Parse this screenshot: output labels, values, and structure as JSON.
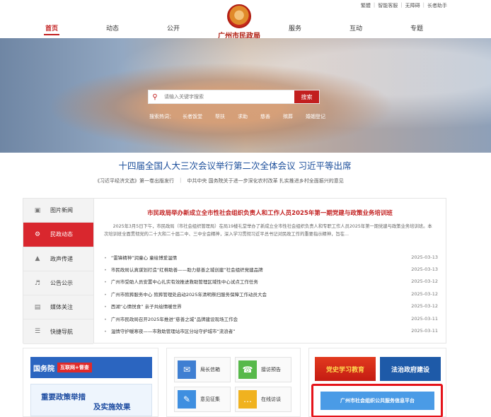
{
  "top_links": [
    "繁體",
    "智能客服",
    "无障碍",
    "长者助手"
  ],
  "nav": {
    "items": [
      "首页",
      "动态",
      "公开",
      "服务",
      "互动",
      "专题"
    ],
    "active_index": 0,
    "logo_text": "广州市民政局"
  },
  "search": {
    "placeholder": "请输入关键字搜索",
    "button_label": "搜索",
    "hot_label": "搜索热词：",
    "hot_keywords": [
      "长者饭堂",
      "帮扶",
      "求助",
      "慈善",
      "殡葬",
      "婚姻登记"
    ]
  },
  "headline": {
    "title": "十四届全国人大三次会议举行第二次全体会议 习近平等出席",
    "sub1": "《习近平经济文选》第一卷出版发行",
    "sub2": "中共中央 国务院关于进一步深化农村改革 扎实推进乡村全面振兴的意见"
  },
  "sidebar": {
    "items": [
      {
        "label": "图片新闻",
        "icon": "image-icon"
      },
      {
        "label": "民政动态",
        "icon": "gear-icon"
      },
      {
        "label": "政声传递",
        "icon": "megaphone-icon"
      },
      {
        "label": "公告公示",
        "icon": "speaker-icon"
      },
      {
        "label": "媒体关注",
        "icon": "document-icon"
      },
      {
        "label": "快捷导航",
        "icon": "list-icon"
      }
    ],
    "active_index": 1
  },
  "news": {
    "featured_title": "市民政局举办新成立全市性社会组织负责人和工作人员2025年第一期党建与政策业务培训班",
    "featured_summary": "2025年3月5日下午，市民政局（市社会组织管理局）在局19楼礼堂举办了新成立全市性社会组织负责人和专职工作人员2025年第一期党建与政策业务培训班。本次培训班全面贯彻党的二十大和二十届二中、三中全会精神，深入学习贯彻习近平总书记对民政工作的重要指示精神，旨在...",
    "items": [
      {
        "title": "“雷锋精神”润童心 童绘博爱温情",
        "date": "2025-03-13"
      },
      {
        "title": "市民政局认真谋划打造“红棉助善——助力慈善之城创建”社会组织党建品牌",
        "date": "2025-03-13"
      },
      {
        "title": "广州市受助人员安置中心扎实有效推进救助管理区域性中心试点工作任务",
        "date": "2025-03-12"
      },
      {
        "title": "广州市殡葬服务中心 殡葬管理处启动2025年清明祭扫服务保障工作动员大会",
        "date": "2025-03-12"
      },
      {
        "title": "西湖“心情悦食” 亲子共绘情暖世界",
        "date": "2025-03-12"
      },
      {
        "title": "广州市民政局召开2025年推进“慈善之城”品牌建设现场工作会",
        "date": "2025-03-11"
      },
      {
        "title": "温情守护暖寒夜——市救助管理站市区分站守护城市“流浪者”",
        "date": "2025-03-11"
      }
    ]
  },
  "cards": {
    "gwy_name": "国务院",
    "gwy_tag": "互联网+督查",
    "policy_line1": "重要政策举措",
    "policy_line2": "及实施效果",
    "services": [
      {
        "label": "局长信箱",
        "icon": "mail-icon",
        "color": "#3f7fd2"
      },
      {
        "label": "接访预告",
        "icon": "chat-icon",
        "color": "#57b94a"
      },
      {
        "label": "意见征集",
        "icon": "edit-icon",
        "color": "#3f8fe0"
      },
      {
        "label": "在线访谈",
        "icon": "bubble-icon",
        "color": "#f0b21f"
      }
    ],
    "party_label": "党史学习教育",
    "law_label": "法治政府建设",
    "platform_label": "广州市社会组织公共服务信息平台"
  },
  "colors": {
    "brand_red": "#c21f1f",
    "highlight_box": "#e5131a",
    "headline_blue": "#1d4f9b"
  }
}
